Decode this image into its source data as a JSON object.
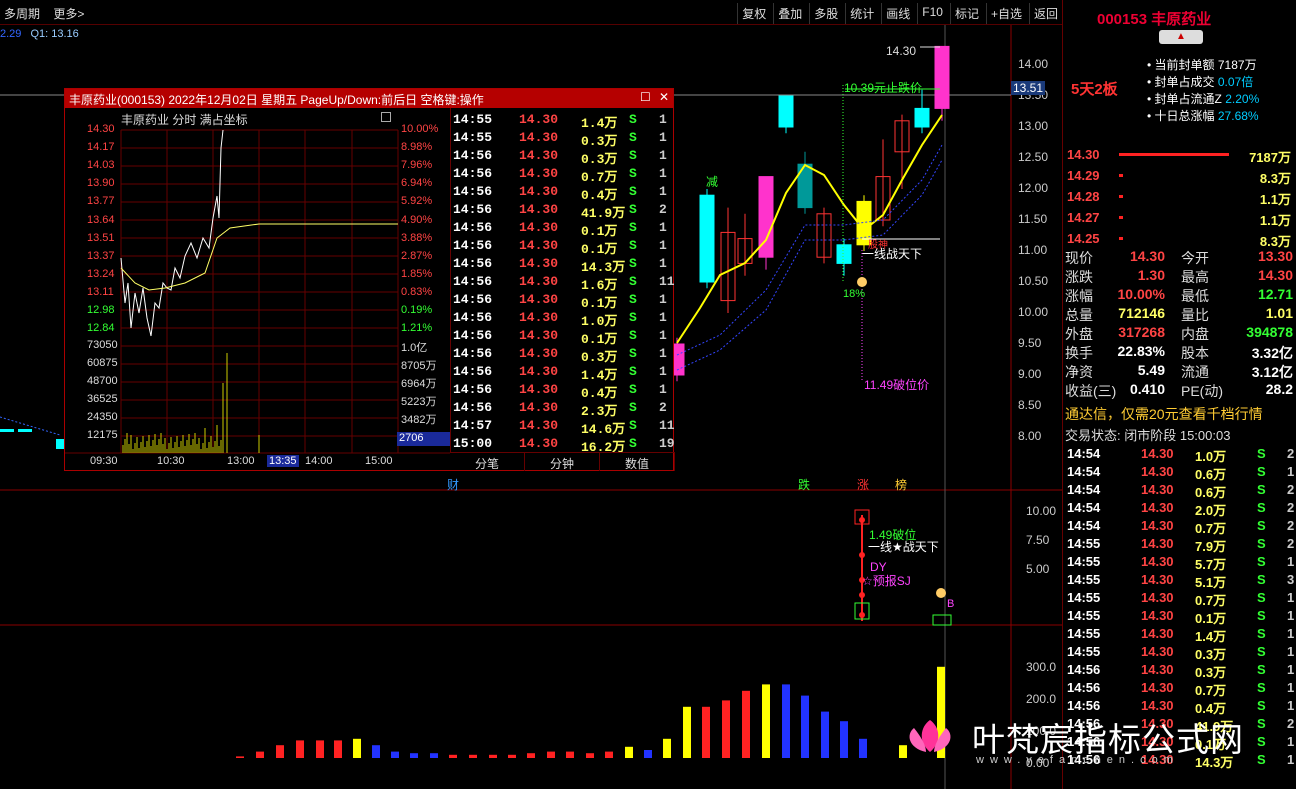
{
  "topbar": {
    "left": [
      "多周期",
      "更多>"
    ],
    "buttons": [
      "复权",
      "叠加",
      "多股",
      "统计",
      "画线",
      "F10",
      "标记",
      "+自选",
      "返回"
    ]
  },
  "q1": {
    "a": "2.29",
    "b": "Q1: 13.16"
  },
  "chart": {
    "price_axis": [
      "14.00",
      "13.50",
      "13.00",
      "12.50",
      "12.00",
      "11.50",
      "11.00",
      "10.50",
      "10.00",
      "9.50",
      "9.00",
      "8.50",
      "8.00"
    ],
    "current_price_tag": "13.51",
    "high_label": "14.30",
    "ann_stop": "10.39元止跌价",
    "ann_break": "11.49破位价",
    "ann_jian": "减",
    "ann_pct": "18%",
    "ann_one": "一线战天下",
    "ann_gushen": "股神",
    "mid_axis": [
      "10.00",
      "7.50",
      "5.00"
    ],
    "mid_ann1": "1.49破位",
    "mid_ann2": "一线★战天下",
    "mid_ann3": "DY",
    "mid_ann4": "☆预报SJ",
    "mid_ann5": "B",
    "bot_axis": [
      "300.0",
      "200.0",
      "100.0",
      "0.00"
    ],
    "markers": {
      "cai": "财",
      "die": "跌",
      "zhang": "涨",
      "bang": "榜"
    }
  },
  "popup": {
    "title": "丰原药业(000153) 2022年12月02日 星期五 PageUp/Down:前后日 空格键:操作",
    "head": "丰原药业  分时  满占坐标",
    "left_axis": [
      "14.30",
      "14.17",
      "14.03",
      "13.90",
      "13.77",
      "13.64",
      "13.51",
      "13.37",
      "13.24",
      "13.11",
      "12.98",
      "12.84",
      "73050",
      "60875",
      "48700",
      "36525",
      "24350",
      "12175"
    ],
    "right_axis": [
      "10.00%",
      "8.98%",
      "7.96%",
      "6.94%",
      "5.92%",
      "4.90%",
      "3.88%",
      "2.87%",
      "1.85%",
      "0.83%",
      "0.19%",
      "1.21%",
      "1.0亿",
      "8705万",
      "6964万",
      "5223万",
      "3482万",
      "1741万"
    ],
    "vol_tag": "2706",
    "time_axis": [
      "09:30",
      "10:30",
      "13:00",
      "13:35",
      "14:00",
      "15:00"
    ],
    "ticks": [
      [
        "14:55",
        "14.30",
        "1.4万",
        "S",
        "1"
      ],
      [
        "14:55",
        "14.30",
        "0.3万",
        "S",
        "1"
      ],
      [
        "14:56",
        "14.30",
        "0.3万",
        "S",
        "1"
      ],
      [
        "14:56",
        "14.30",
        "0.7万",
        "S",
        "1"
      ],
      [
        "14:56",
        "14.30",
        "0.4万",
        "S",
        "1"
      ],
      [
        "14:56",
        "14.30",
        "41.9万",
        "S",
        "2"
      ],
      [
        "14:56",
        "14.30",
        "0.1万",
        "S",
        "1"
      ],
      [
        "14:56",
        "14.30",
        "0.1万",
        "S",
        "1"
      ],
      [
        "14:56",
        "14.30",
        "14.3万",
        "S",
        "1"
      ],
      [
        "14:56",
        "14.30",
        "1.6万",
        "S",
        "11"
      ],
      [
        "14:56",
        "14.30",
        "0.1万",
        "S",
        "1"
      ],
      [
        "14:56",
        "14.30",
        "1.0万",
        "S",
        "1"
      ],
      [
        "14:56",
        "14.30",
        "0.1万",
        "S",
        "1"
      ],
      [
        "14:56",
        "14.30",
        "0.3万",
        "S",
        "1"
      ],
      [
        "14:56",
        "14.30",
        "1.4万",
        "S",
        "1"
      ],
      [
        "14:56",
        "14.30",
        "0.4万",
        "S",
        "1"
      ],
      [
        "14:56",
        "14.30",
        "2.3万",
        "S",
        "2"
      ],
      [
        "14:57",
        "14.30",
        "14.6万",
        "S",
        "11"
      ],
      [
        "15:00",
        "14.30",
        "16.2万",
        "S",
        "19"
      ]
    ],
    "tabs": [
      "分笔",
      "分钟",
      "数值"
    ]
  },
  "right": {
    "code_title": "000153 丰原药业",
    "badge": "5天2板",
    "info": [
      [
        "当前封单额",
        "7187万"
      ],
      [
        "封单占成交",
        "0.07倍"
      ],
      [
        "封单占流通Z",
        "2.20%"
      ],
      [
        "十日总涨幅",
        "27.68%"
      ]
    ],
    "order_book": [
      [
        "14.30",
        "7187万"
      ],
      [
        "14.29",
        "8.3万"
      ],
      [
        "14.28",
        "1.1万"
      ],
      [
        "14.27",
        "1.1万"
      ],
      [
        "14.25",
        "8.3万"
      ]
    ],
    "quote": [
      [
        "现价",
        "14.30",
        "今开",
        "13.30"
      ],
      [
        "涨跌",
        "1.30",
        "最高",
        "14.30"
      ],
      [
        "涨幅",
        "10.00%",
        "最低",
        "12.71"
      ],
      [
        "总量",
        "712146",
        "量比",
        "1.01"
      ],
      [
        "外盘",
        "317268",
        "内盘",
        "394878"
      ],
      [
        "换手",
        "22.83%",
        "股本",
        "3.32亿"
      ],
      [
        "净资",
        "5.49",
        "流通",
        "3.12亿"
      ],
      [
        "收益(三)",
        "0.410",
        "PE(动)",
        "28.2"
      ]
    ],
    "promo": "通达信，仅需20元查看千档行情",
    "status": "交易状态: 闭市阶段 15:00:03",
    "ticks": [
      [
        "14:54",
        "14.30",
        "1.0万",
        "S",
        "2"
      ],
      [
        "14:54",
        "14.30",
        "0.6万",
        "S",
        "1"
      ],
      [
        "14:54",
        "14.30",
        "0.6万",
        "S",
        "2"
      ],
      [
        "14:54",
        "14.30",
        "2.0万",
        "S",
        "2"
      ],
      [
        "14:54",
        "14.30",
        "0.7万",
        "S",
        "2"
      ],
      [
        "14:55",
        "14.30",
        "7.9万",
        "S",
        "2"
      ],
      [
        "14:55",
        "14.30",
        "5.7万",
        "S",
        "1"
      ],
      [
        "14:55",
        "14.30",
        "5.1万",
        "S",
        "3"
      ],
      [
        "14:55",
        "14.30",
        "0.7万",
        "S",
        "1"
      ],
      [
        "14:55",
        "14.30",
        "0.1万",
        "S",
        "1"
      ],
      [
        "14:55",
        "14.30",
        "1.4万",
        "S",
        "1"
      ],
      [
        "14:55",
        "14.30",
        "0.3万",
        "S",
        "1"
      ],
      [
        "14:56",
        "14.30",
        "0.3万",
        "S",
        "1"
      ],
      [
        "14:56",
        "14.30",
        "0.7万",
        "S",
        "1"
      ],
      [
        "14:56",
        "14.30",
        "0.4万",
        "S",
        "1"
      ],
      [
        "14:56",
        "14.30",
        "41.9万",
        "S",
        "2"
      ],
      [
        "14:56",
        "14.30",
        "0.1万",
        "S",
        "1"
      ],
      [
        "14:56",
        "14.30",
        "14.3万",
        "S",
        "1"
      ]
    ]
  },
  "watermark": {
    "title": "叶梵宸指标公式网",
    "url": "www.yefanchen.com"
  },
  "colors": {
    "up": "#ff3333",
    "down": "#00cc00",
    "magenta": "#ff33cc",
    "cyan": "#00ffff",
    "yellow": "#ffff00",
    "blue": "#2233ff"
  }
}
